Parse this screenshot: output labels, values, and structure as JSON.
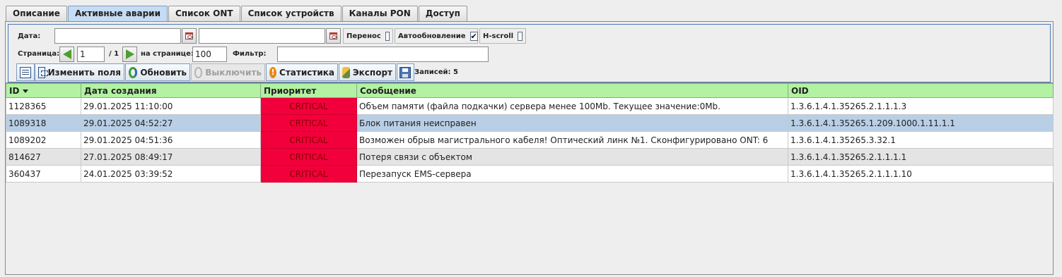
{
  "tabs": [
    {
      "label": "Описание"
    },
    {
      "label": "Активные аварии"
    },
    {
      "label": "Список ONT"
    },
    {
      "label": "Список устройств"
    },
    {
      "label": "Каналы PON"
    },
    {
      "label": "Доступ"
    }
  ],
  "active_tab": "Активные аварии",
  "filters": {
    "date_label": "Дата:",
    "date_from": "",
    "date_to": "",
    "wrap_label": "Перенос",
    "wrap_checked": "",
    "autoupdate_label": "Автообновление",
    "autoupdate_checked": "✔",
    "hscroll_label": "H-scroll",
    "hscroll_checked": ""
  },
  "paging": {
    "page_label": "Страница:",
    "page_value": "1",
    "page_total": "/ 1",
    "per_page_label": "на странице:",
    "per_page_value": "100",
    "filter_label": "Фильтр:",
    "filter_value": ""
  },
  "toolbar": {
    "change_fields": "Изменить поля",
    "refresh": "Обновить",
    "disable": "Выключить",
    "statistics": "Статистика",
    "export": "Экспорт",
    "records": "Записей: 5"
  },
  "table": {
    "columns": [
      "ID",
      "Дата создания",
      "Приоритет",
      "Сообщение",
      "OID"
    ],
    "rows": [
      [
        "1128365",
        "29.01.2025 11:10:00",
        "CRITICAL",
        "Объем памяти (файла подкачки) сервера менее 100Mb. Текущее значение:0Mb.",
        "1.3.6.1.4.1.35265.2.1.1.1.3"
      ],
      [
        "1089318",
        "29.01.2025 04:52:27",
        "CRITICAL",
        "Блок питания неисправен",
        "1.3.6.1.4.1.35265.1.209.1000.1.11.1.1"
      ],
      [
        "1089202",
        "29.01.2025 04:51:36",
        "CRITICAL",
        "Возможен обрыв магистрального кабеля! Оптический линк №1. Сконфигурировано ONT: 6",
        "1.3.6.1.4.1.35265.3.32.1"
      ],
      [
        "814627",
        "27.01.2025 08:49:17",
        "CRITICAL",
        "Потеря связи с объектом",
        "1.3.6.1.4.1.35265.2.1.1.1.1"
      ],
      [
        "360437",
        "24.01.2025 03:39:52",
        "CRITICAL",
        "Перезапуск EMS-сервера",
        "1.3.6.1.4.1.35265.2.1.1.1.10"
      ]
    ]
  },
  "colors": {
    "header_bg": "#b2f2a2",
    "critical_bg": "#f2003c",
    "selected_row": "#b8cfe5",
    "active_tab": "#c6dcf2"
  }
}
